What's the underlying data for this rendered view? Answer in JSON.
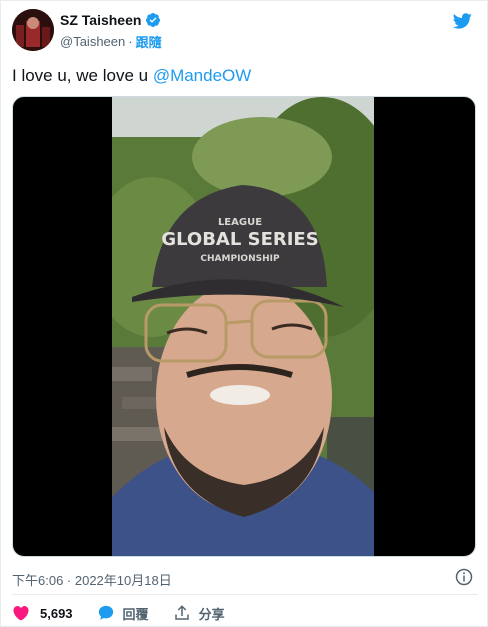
{
  "tweet": {
    "author": {
      "display_name": "SZ Taisheen",
      "handle": "@Taisheen",
      "separator": "·",
      "follow_label": "跟隨",
      "verified": true
    },
    "text_prefix": "I love u, we love u ",
    "mention": "@MandeOW",
    "timestamp": "下午6:06 · 2022年10月18日",
    "stats": {
      "likes": "5,693"
    },
    "actions": {
      "reply_label": "回覆",
      "share_label": "分享"
    },
    "colors": {
      "accent": "#1d9bf0",
      "like": "#f91880",
      "text": "#0f1419",
      "secondary": "#536471"
    },
    "icons": {
      "logo": "twitter-bird-icon",
      "verified": "verified-badge-icon",
      "info": "info-icon",
      "like": "heart-icon",
      "reply": "speech-bubble-icon",
      "share": "share-upload-icon"
    }
  },
  "media": {
    "type": "video"
  }
}
